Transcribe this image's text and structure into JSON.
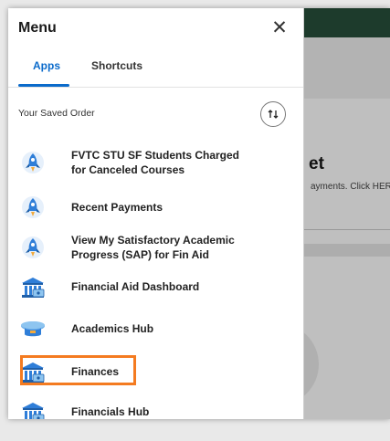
{
  "background": {
    "title": "et",
    "description": "ayments. Click HERE"
  },
  "menu": {
    "title": "Menu",
    "close_icon": "close-icon",
    "tabs": [
      {
        "label": "Apps",
        "active": true
      },
      {
        "label": "Shortcuts",
        "active": false
      }
    ],
    "saved_order_label": "Your Saved Order",
    "sort_icon": "sort-arrows-icon",
    "items": [
      {
        "label": "FVTC STU SF Students Charged for Canceled Courses",
        "icon": "rocket-icon"
      },
      {
        "label": "Recent Payments",
        "icon": "rocket-icon"
      },
      {
        "label": "View My Satisfactory Academic Progress (SAP) for Fin Aid",
        "icon": "rocket-icon"
      },
      {
        "label": "Financial Aid Dashboard",
        "icon": "bank-icon"
      },
      {
        "label": "Academics Hub",
        "icon": "graduation-cap-icon"
      },
      {
        "label": "Finances",
        "icon": "bank-icon"
      },
      {
        "label": "Financials Hub",
        "icon": "bank-icon"
      }
    ]
  },
  "colors": {
    "accent": "#0b6bcb",
    "highlight": "#f47b20",
    "icon_blue": "#2f7ed8"
  }
}
